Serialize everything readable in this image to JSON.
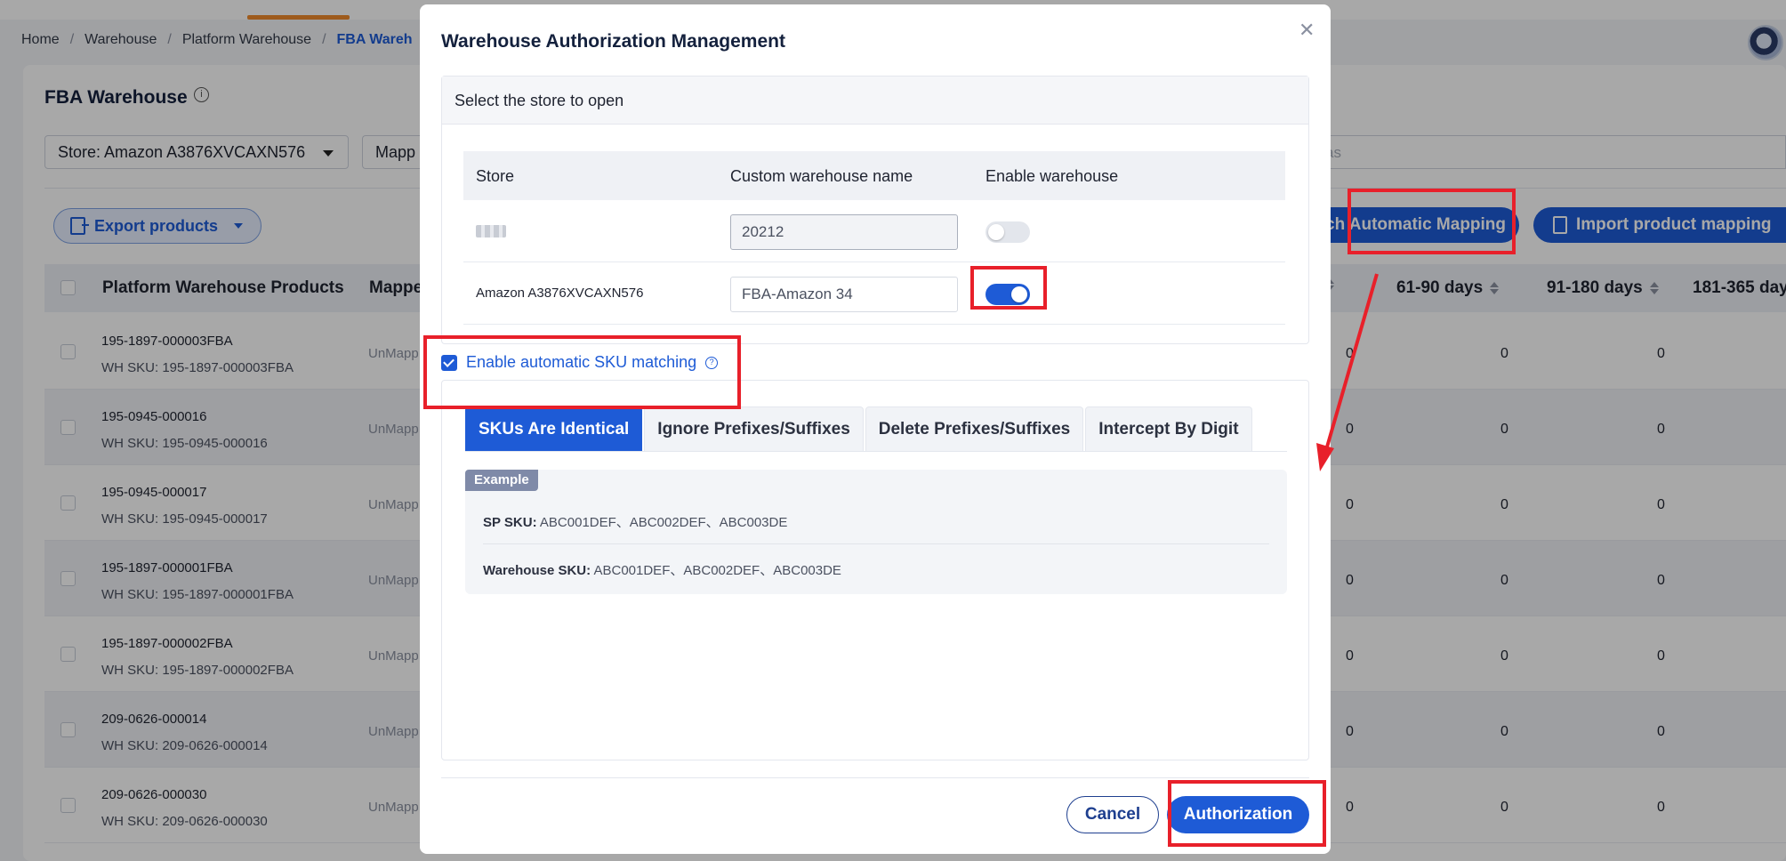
{
  "breadcrumb": [
    "Home",
    "Warehouse",
    "Platform Warehouse",
    "FBA Wareh"
  ],
  "page": {
    "title": "FBA Warehouse",
    "store_filter": "Store: Amazon A3876XVCAXN576",
    "mapping_filter": "Mapp",
    "search_placeholder": "as",
    "export_label": "Export products",
    "auto_mapping_label": "ch Automatic Mapping",
    "import_mapping_label": "Import product mapping"
  },
  "table": {
    "columns": [
      "Platform Warehouse Products",
      "Mappe",
      "61-90 days",
      "91-180 days",
      "181-365 day"
    ],
    "rows": [
      {
        "sku": "195-1897-000003FBA",
        "wh": "WH SKU: 195-1897-000003FBA",
        "mapped": "UnMapp",
        "c1": "0",
        "c2": "0",
        "c3": "0"
      },
      {
        "sku": "195-0945-000016",
        "wh": "WH SKU: 195-0945-000016",
        "mapped": "UnMapp",
        "c1": "0",
        "c2": "0",
        "c3": "0"
      },
      {
        "sku": "195-0945-000017",
        "wh": "WH SKU: 195-0945-000017",
        "mapped": "UnMapp",
        "c1": "0",
        "c2": "0",
        "c3": "0"
      },
      {
        "sku": "195-1897-000001FBA",
        "wh": "WH SKU: 195-1897-000001FBA",
        "mapped": "UnMapp",
        "c1": "0",
        "c2": "0",
        "c3": "0"
      },
      {
        "sku": "195-1897-000002FBA",
        "wh": "WH SKU: 195-1897-000002FBA",
        "mapped": "UnMapp",
        "c1": "0",
        "c2": "0",
        "c3": "0"
      },
      {
        "sku": "209-0626-000014",
        "wh": "WH SKU: 209-0626-000014",
        "mapped": "UnMapp",
        "c1": "0",
        "c2": "0",
        "c3": "0"
      },
      {
        "sku": "209-0626-000030",
        "wh": "WH SKU: 209-0626-000030",
        "mapped": "UnMapp",
        "c1": "0",
        "c2": "0",
        "c3": "0"
      }
    ]
  },
  "modal": {
    "title": "Warehouse Authorization Management",
    "section_label": "Select the store to open",
    "columns": [
      "Store",
      "Custom warehouse name",
      "Enable warehouse"
    ],
    "stores": [
      {
        "store": "",
        "warehouse_name": "20212",
        "enabled": false
      },
      {
        "store": "Amazon A3876XVCAXN576",
        "warehouse_name": "FBA-Amazon 34",
        "enabled": true
      }
    ],
    "auto_sku_label": "Enable automatic SKU matching",
    "auto_sku_checked": true,
    "tabs": [
      "SKUs Are Identical",
      "Ignore Prefixes/Suffixes",
      "Delete Prefixes/Suffixes",
      "Intercept By Digit"
    ],
    "active_tab": 0,
    "example_label": "Example",
    "sp_sku_label": "SP SKU:",
    "sp_sku_value": "ABC001DEF、ABC002DEF、ABC003DE",
    "wh_sku_label": "Warehouse SKU:",
    "wh_sku_value": "ABC001DEF、ABC002DEF、ABC003DE",
    "cancel_label": "Cancel",
    "authorize_label": "Authorization"
  },
  "colors": {
    "primary": "#1e5bd6",
    "annotation": "#e8202a",
    "nav_accent": "#f08a2c"
  }
}
